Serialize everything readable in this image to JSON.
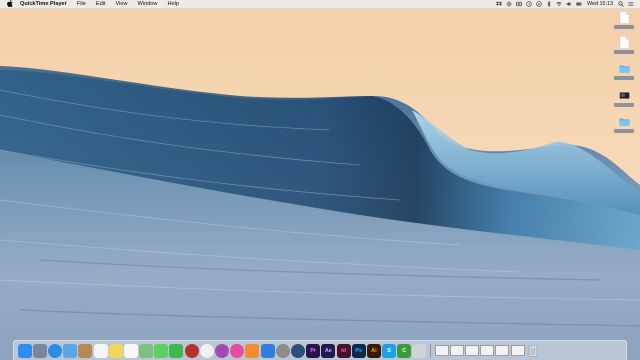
{
  "menubar": {
    "app_name": "QuickTime Player",
    "items": [
      "File",
      "Edit",
      "View",
      "Window",
      "Help"
    ],
    "clock": "Wed 15:13"
  },
  "desktop": {
    "icons": [
      "document",
      "document",
      "folder",
      "screenshot",
      "folder"
    ]
  },
  "dock": {
    "apps": [
      {
        "icon": "finder-icon",
        "color": "#2f8cf0",
        "label": ""
      },
      {
        "icon": "launchpad-icon",
        "color": "#7a8799",
        "label": ""
      },
      {
        "icon": "safari-icon",
        "color": "#2a8ee8",
        "label": ""
      },
      {
        "icon": "mail-icon",
        "color": "#5aa7e6",
        "label": ""
      },
      {
        "icon": "contacts-icon",
        "color": "#b48a52",
        "label": ""
      },
      {
        "icon": "calendar-icon",
        "color": "#f4f4f4",
        "label": ""
      },
      {
        "icon": "notes-icon",
        "color": "#f2d65a",
        "label": ""
      },
      {
        "icon": "reminders-icon",
        "color": "#f7f7f7",
        "label": ""
      },
      {
        "icon": "maps-icon",
        "color": "#7fc07d",
        "label": ""
      },
      {
        "icon": "messages-icon",
        "color": "#5fcf63",
        "label": ""
      },
      {
        "icon": "facetime-icon",
        "color": "#3dbb52",
        "label": ""
      },
      {
        "icon": "photobooth-icon",
        "color": "#b8332d",
        "label": ""
      },
      {
        "icon": "photos-icon",
        "color": "#f1f1f1",
        "label": ""
      },
      {
        "icon": "game-center-icon",
        "color": "#a44ab0",
        "label": ""
      },
      {
        "icon": "itunes-icon",
        "color": "#e74b9c",
        "label": ""
      },
      {
        "icon": "ibooks-icon",
        "color": "#f48a2b",
        "label": ""
      },
      {
        "icon": "app-store-icon",
        "color": "#2d7fe0",
        "label": ""
      },
      {
        "icon": "system-preferences-icon",
        "color": "#8c8c8c",
        "label": ""
      },
      {
        "icon": "quicktime-icon",
        "color": "#2d4f7a",
        "label": ""
      },
      {
        "icon": "premiere-icon",
        "color": "#2a1446",
        "label": "Pr"
      },
      {
        "icon": "after-effects-icon",
        "color": "#201a4a",
        "label": "Ae"
      },
      {
        "icon": "indesign-icon",
        "color": "#4a0f2a",
        "label": "Id"
      },
      {
        "icon": "photoshop-icon",
        "color": "#0c2a4a",
        "label": "Ps"
      },
      {
        "icon": "illustrator-icon",
        "color": "#3a1a02",
        "label": "Ai"
      },
      {
        "icon": "skype-icon",
        "color": "#1da1e6",
        "label": "S"
      },
      {
        "icon": "camtasia-icon",
        "color": "#3b9b3c",
        "label": "C"
      },
      {
        "icon": "utility-icon",
        "color": "#cfd3d8",
        "label": ""
      }
    ],
    "thumbs": [
      "window",
      "window",
      "window",
      "window",
      "window",
      "window"
    ]
  }
}
